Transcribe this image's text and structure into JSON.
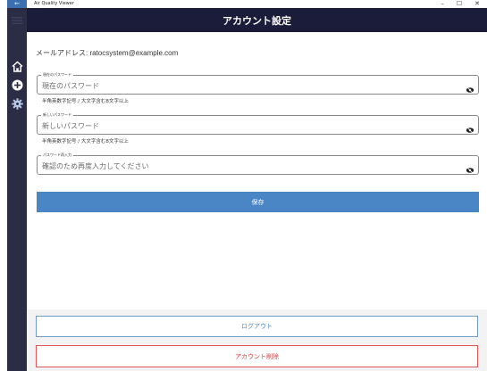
{
  "window": {
    "app_title": "Air Quality Viewer",
    "back_glyph": "←",
    "minimize_glyph": "–",
    "maximize_glyph": "☐",
    "close_glyph": "✕"
  },
  "nav": {
    "items": [
      {
        "icon": "menu-icon"
      },
      {
        "icon": "home-icon"
      },
      {
        "icon": "add-circle-icon"
      },
      {
        "icon": "gear-icon"
      }
    ]
  },
  "header": {
    "title": "アカウント設定"
  },
  "account": {
    "email_label": "メールアドレス:",
    "email": "ratocsystem@example.com"
  },
  "fields": {
    "current": {
      "legend": "現在のパスワード",
      "placeholder": "現在のパスワード"
    },
    "new": {
      "legend": "新しいパスワード",
      "placeholder": "新しいパスワード"
    },
    "confirm": {
      "legend": "パスワード再入力",
      "placeholder": "確認のため再度入力してください"
    },
    "hint": "半角英数字記号 / 大文字含む8文字以上"
  },
  "buttons": {
    "save": "保存",
    "logout": "ログアウト",
    "delete": "アカウント削除"
  },
  "colors": {
    "header_bg": "#1b1c3a",
    "rail_bg": "#2b2d45",
    "accent": "#4a86c5",
    "danger": "#d43c3c"
  }
}
